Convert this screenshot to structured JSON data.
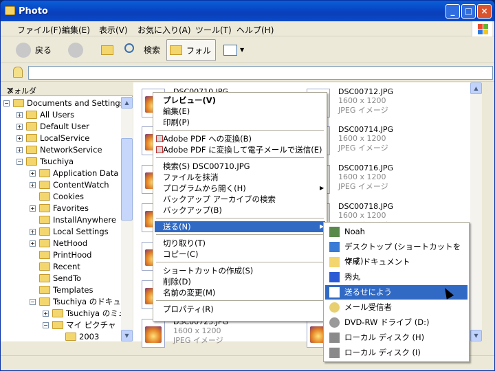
{
  "window": {
    "title": "Photo"
  },
  "menubar": [
    "ファイル(F)",
    "編集(E)",
    "表示(V)",
    "お気に入り(A)",
    "ツール(T)",
    "ヘルプ(H)"
  ],
  "toolbar": {
    "back": "戻る",
    "search": "検索",
    "folders": "フォルダ"
  },
  "folder_pane": {
    "title": "フォルダ",
    "close": "×"
  },
  "tree": [
    {
      "label": "Documents and Settings",
      "indent": 0,
      "exp": "−"
    },
    {
      "label": "All Users",
      "indent": 1,
      "exp": "+"
    },
    {
      "label": "Default User",
      "indent": 1,
      "exp": "+"
    },
    {
      "label": "LocalService",
      "indent": 1,
      "exp": "+"
    },
    {
      "label": "NetworkService",
      "indent": 1,
      "exp": "+"
    },
    {
      "label": "Tsuchiya",
      "indent": 1,
      "exp": "−"
    },
    {
      "label": "Application Data",
      "indent": 2,
      "exp": "+"
    },
    {
      "label": "ContentWatch",
      "indent": 2,
      "exp": "+"
    },
    {
      "label": "Cookies",
      "indent": 2,
      "exp": ""
    },
    {
      "label": "Favorites",
      "indent": 2,
      "exp": "+"
    },
    {
      "label": "InstallAnywhere",
      "indent": 2,
      "exp": ""
    },
    {
      "label": "Local Settings",
      "indent": 2,
      "exp": "+"
    },
    {
      "label": "NetHood",
      "indent": 2,
      "exp": "+"
    },
    {
      "label": "PrintHood",
      "indent": 2,
      "exp": ""
    },
    {
      "label": "Recent",
      "indent": 2,
      "exp": ""
    },
    {
      "label": "SendTo",
      "indent": 2,
      "exp": ""
    },
    {
      "label": "Templates",
      "indent": 2,
      "exp": ""
    },
    {
      "label": "Tsuchiya のドキュメント",
      "indent": 2,
      "exp": "−"
    },
    {
      "label": "Tsuchiya のミュージッ",
      "indent": 3,
      "exp": "+"
    },
    {
      "label": "マイ ピクチャ",
      "indent": 3,
      "exp": "−"
    },
    {
      "label": "2003",
      "indent": 4,
      "exp": ""
    }
  ],
  "files": [
    {
      "name": "DSC00710.JPG",
      "dims": "",
      "type": ""
    },
    {
      "name": "DSC00712.JPG",
      "dims": "1600 x 1200",
      "type": "JPEG イメージ"
    },
    {
      "name": "DSC00714.JPG",
      "dims": "1600 x 1200",
      "type": "JPEG イメージ"
    },
    {
      "name": "DSC00716.JPG",
      "dims": "1600 x 1200",
      "type": "JPEG イメージ"
    },
    {
      "name": "DSC00718.JPG",
      "dims": "1600 x 1200",
      "type": "JPEG イメージ"
    },
    {
      "name": "DSC00723.JPG",
      "dims": "1600 x 1200",
      "type": "JPEG イメージ"
    }
  ],
  "context_menu": [
    {
      "label": "プレビュー(V)",
      "bold": true
    },
    {
      "label": "編集(E)"
    },
    {
      "label": "印刷(P)"
    },
    {
      "sep": true
    },
    {
      "label": "Adobe PDF への変換(B)",
      "pdf": true
    },
    {
      "label": "Adobe PDF に変換して電子メールで送信(E)",
      "pdf": true
    },
    {
      "sep": true
    },
    {
      "label": "検索(S) DSC00710.JPG"
    },
    {
      "label": "ファイルを抹消"
    },
    {
      "label": "プログラムから開く(H)",
      "sub": true
    },
    {
      "label": "バックアップ アーカイブの検索"
    },
    {
      "label": "バックアップ(B)"
    },
    {
      "sep": true
    },
    {
      "label": "送る(N)",
      "sub": true,
      "hl": true
    },
    {
      "sep": true
    },
    {
      "label": "切り取り(T)"
    },
    {
      "label": "コピー(C)"
    },
    {
      "sep": true
    },
    {
      "label": "ショートカットの作成(S)"
    },
    {
      "label": "削除(D)"
    },
    {
      "label": "名前の変更(M)"
    },
    {
      "sep": true
    },
    {
      "label": "プロパティ(R)"
    }
  ],
  "sendto_menu": [
    {
      "label": "Noah",
      "icon": "noah-icon"
    },
    {
      "label": "デスクトップ (ショートカットを作成)",
      "icon": "desktop-icon"
    },
    {
      "label": "マイ ドキュメント",
      "icon": "my-documents-icon"
    },
    {
      "label": "秀丸",
      "icon": "hidemaru-icon"
    },
    {
      "label": "送るせによう",
      "icon": "sendto-icon",
      "hl": true
    },
    {
      "label": "メール受信者",
      "icon": "mail-icon"
    },
    {
      "label": "DVD-RW ドライブ (D:)",
      "icon": "dvd-drive-icon"
    },
    {
      "label": "ローカル ディスク (H)",
      "icon": "disk-icon"
    },
    {
      "label": "ローカル ディスク (I)",
      "icon": "disk-icon"
    }
  ]
}
